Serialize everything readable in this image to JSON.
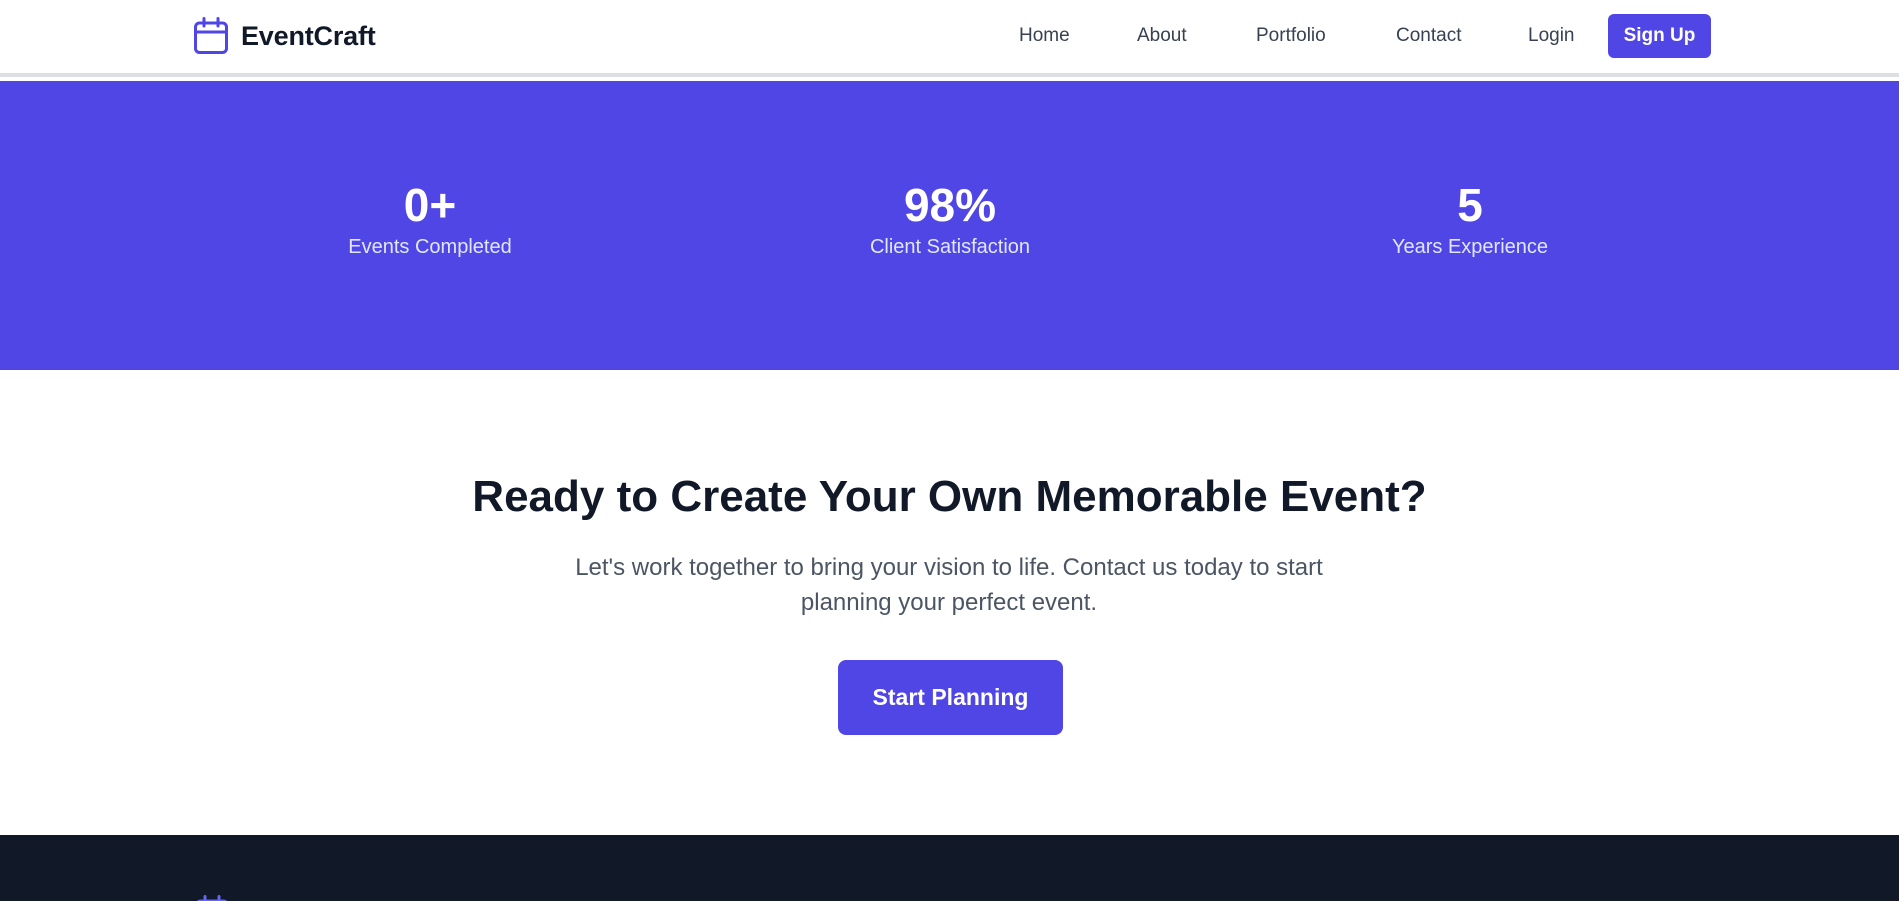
{
  "brand": {
    "name": "EventCraft",
    "icon": "calendar-icon"
  },
  "nav": {
    "home": "Home",
    "about": "About",
    "portfolio": "Portfolio",
    "contact": "Contact",
    "login": "Login",
    "signup": "Sign Up"
  },
  "stats": [
    {
      "value": "0+",
      "label": "Events Completed"
    },
    {
      "value": "98%",
      "label": "Client Satisfaction"
    },
    {
      "value": "5",
      "label": "Years Experience"
    }
  ],
  "cta": {
    "title": "Ready to Create Your Own Memorable Event?",
    "text": "Let's work together to bring your vision to life. Contact us today to start planning your perfect event.",
    "button": "Start Planning"
  },
  "footer": {
    "icon": "calendar-icon"
  },
  "colors": {
    "primary": "#4f46e5",
    "footer_bg": "#111827",
    "heading": "#111827",
    "body_text": "#4b5563",
    "stat_label": "#e0e7ff"
  }
}
